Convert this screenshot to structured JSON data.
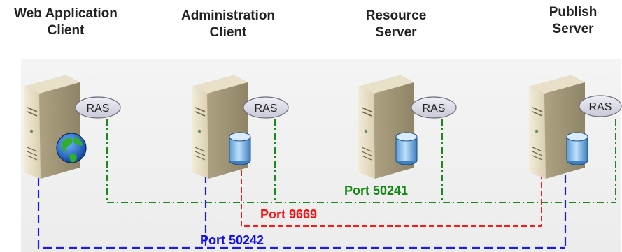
{
  "nodes": [
    {
      "id": "web-application-client",
      "line1": "Web Application",
      "line2": "Client",
      "badge": "RAS",
      "icon": "globe-icon"
    },
    {
      "id": "administration-client",
      "line1": "Administration",
      "line2": "Client",
      "badge": "RAS",
      "icon": "database-icon"
    },
    {
      "id": "resource-server",
      "line1": "Resource",
      "line2": "Server",
      "badge": "RAS",
      "icon": "database-icon"
    },
    {
      "id": "publish-server",
      "line1": "Publish",
      "line2": "Server",
      "badge": "RAS",
      "icon": "database-icon"
    }
  ],
  "connections": [
    {
      "label": "Port 50241",
      "color": "#008000",
      "style": "dash-dot",
      "links": [
        "web-application-client",
        "administration-client",
        "resource-server",
        "publish-server"
      ]
    },
    {
      "label": "Port 9669",
      "color": "#ff0000",
      "style": "dashed",
      "links": [
        "administration-client",
        "publish-server"
      ]
    },
    {
      "label": "Port 50242",
      "color": "#0000dd",
      "style": "dashed",
      "links": [
        "web-application-client",
        "administration-client",
        "publish-server"
      ]
    }
  ]
}
